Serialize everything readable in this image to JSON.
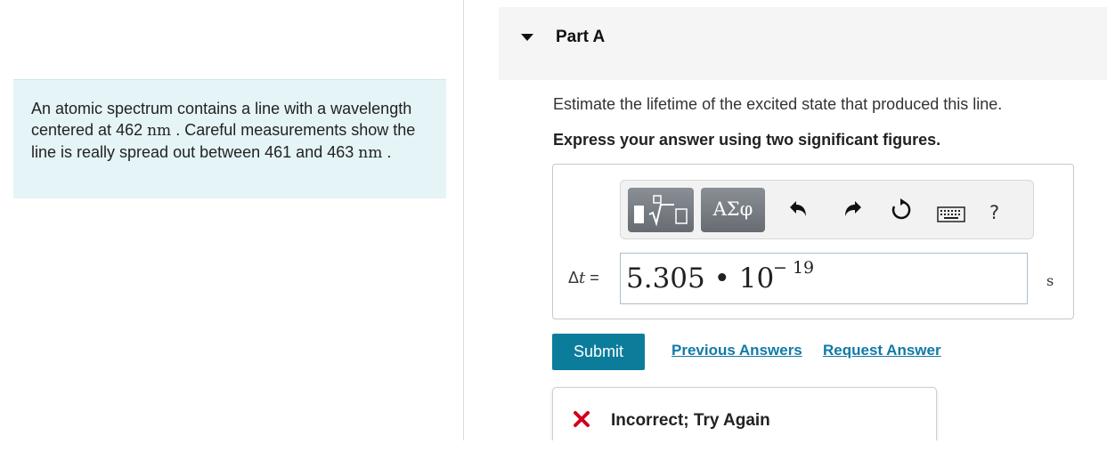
{
  "problem": {
    "text_part1": "An atomic spectrum contains a line with a wavelength centered at 462 ",
    "unit1": "nm",
    "text_part2": " . Careful measurements show the line is really spread out between 461 and 463 ",
    "unit2": "nm",
    "text_part3": " ."
  },
  "part": {
    "title": "Part A",
    "collapse_icon": "caret-down-icon"
  },
  "question": {
    "prompt": "Estimate the lifetime of the excited state that produced this line.",
    "instruction": "Express your answer using two significant figures."
  },
  "toolbar": {
    "templates_icon": "templates-icon",
    "symbols_label": "ΑΣφ",
    "undo_icon": "undo-icon",
    "redo_icon": "redo-icon",
    "reset_icon": "reset-icon",
    "keyboard_icon": "keyboard-icon",
    "help_label": "?"
  },
  "answer": {
    "variable_symbol": "Δ",
    "variable_italic": "t",
    "equals": " =",
    "mantissa": "5.305 • 10",
    "exponent": "− 19",
    "unit": "s"
  },
  "actions": {
    "submit_label": "Submit",
    "previous_answers_label": "Previous Answers",
    "request_answer_label": "Request Answer"
  },
  "feedback": {
    "status_icon": "x-mark-icon",
    "message": "Incorrect; Try Again",
    "status_color": "#d0021b"
  },
  "colors": {
    "accent": "#0c7c9b",
    "link": "#117aa6",
    "problem_bg": "#e5f4f6"
  }
}
